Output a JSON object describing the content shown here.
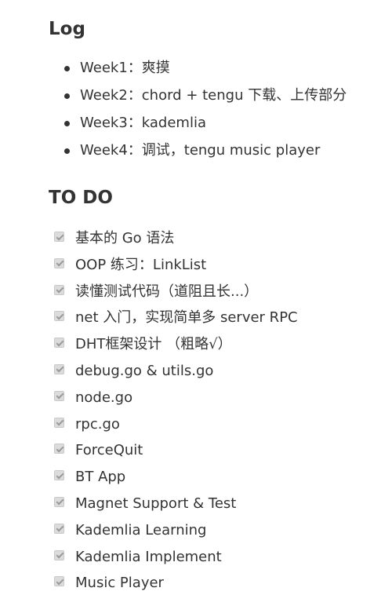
{
  "log": {
    "heading": "Log",
    "items": [
      "Week1：爽摸",
      "Week2：chord + tengu 下载、上传部分",
      "Week3：kademlia",
      "Week4：调试，tengu music player"
    ]
  },
  "todo": {
    "heading": "TO DO",
    "items": [
      {
        "label": "基本的 Go 语法",
        "checked": true
      },
      {
        "label": "OOP 练习：LinkList",
        "checked": true
      },
      {
        "label": "读懂测试代码（道阻且长...）",
        "checked": true
      },
      {
        "label": "net 入门，实现简单多 server RPC",
        "checked": true
      },
      {
        "label": "DHT框架设计 （粗略√）",
        "checked": true
      },
      {
        "label": "debug.go & utils.go",
        "checked": true
      },
      {
        "label": "node.go",
        "checked": true
      },
      {
        "label": "rpc.go",
        "checked": true
      },
      {
        "label": "ForceQuit",
        "checked": true
      },
      {
        "label": "BT App",
        "checked": true
      },
      {
        "label": "Magnet Support & Test",
        "checked": true
      },
      {
        "label": "Kademlia Learning",
        "checked": true
      },
      {
        "label": "Kademlia Implement",
        "checked": true
      },
      {
        "label": "Music Player",
        "checked": true
      }
    ]
  }
}
